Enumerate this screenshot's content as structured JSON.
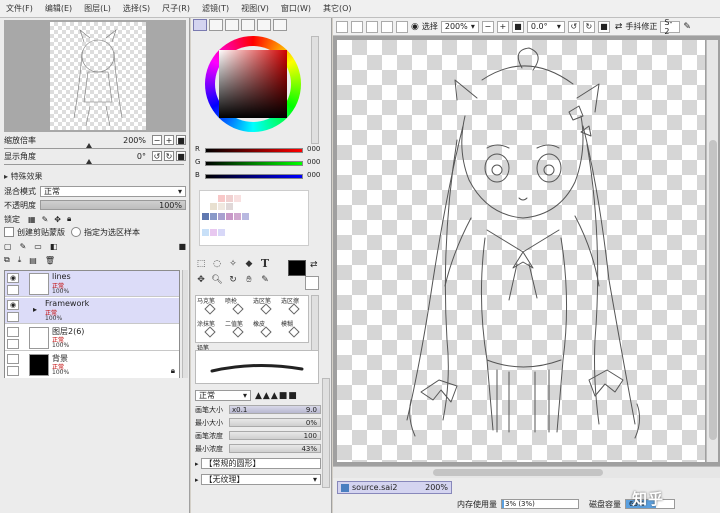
{
  "menubar": {
    "items": [
      "文件(F)",
      "编辑(E)",
      "图层(L)",
      "选择(S)",
      "尺子(R)",
      "滤镜(T)",
      "视图(V)",
      "窗口(W)",
      "其它(O)"
    ]
  },
  "navigator": {
    "zoom_label": "缩放倍率",
    "zoom_value": "200%",
    "angle_label": "显示角度",
    "angle_value": "0°"
  },
  "layer_panel": {
    "effects_label": "特殊效果",
    "blend_label": "混合模式",
    "blend_value": "正常",
    "opacity_label": "不透明度",
    "opacity_value": "100%",
    "lock_label": "锁定",
    "clip_label": "创建剪贴蒙版",
    "select_sample_label": "指定为选区样本",
    "layers": [
      {
        "name": "lines",
        "mode": "正常",
        "opacity": "100%"
      },
      {
        "name": "Framework",
        "mode": "正常",
        "opacity": "100%"
      },
      {
        "name": "图层2(6)",
        "mode": "正常",
        "opacity": "100%"
      },
      {
        "name": "背景",
        "mode": "正常",
        "opacity": "100%"
      }
    ]
  },
  "color_panel": {
    "r_label": "R",
    "g_label": "G",
    "b_label": "B",
    "r_value": "000",
    "g_value": "000",
    "b_value": "000",
    "accent": "#d00000"
  },
  "tools": {
    "tool_text": "T",
    "brushes": [
      "马克笔",
      "喷枪",
      "选区笔",
      "选区擦",
      "涂抹笔",
      "二值笔",
      "橡皮",
      "模糊",
      "铅笔"
    ],
    "blend_mode": "正常",
    "size_label": "画笔大小",
    "size_mult": "x0.1",
    "size_value": "9.0",
    "min_size_label": "最小大小",
    "min_size_value": "0%",
    "density_label": "画笔浓度",
    "density_value": "100",
    "min_density_label": "最小浓度",
    "min_density_value": "43%",
    "shape_label": "【常规的圆形】",
    "texture_label": "【无纹理】"
  },
  "canvas_toolbar": {
    "select_label": "选择",
    "zoom_value": "200%",
    "angle_value": "0.0°",
    "stabilizer_label": "手抖修正",
    "stabilizer_value": "S-2"
  },
  "status": {
    "file_name": "source.sai2",
    "file_zoom": "200%",
    "memory_label": "内存使用量",
    "memory_value": "3% (3%)",
    "memory_pct": 3,
    "disk_label": "磁盘容量",
    "disk_value": "63%",
    "disk_pct": 63
  },
  "watermark": "知乎",
  "colors": {
    "canvas_bg": "#a0a0a0",
    "selection": "#d4d4f0"
  }
}
